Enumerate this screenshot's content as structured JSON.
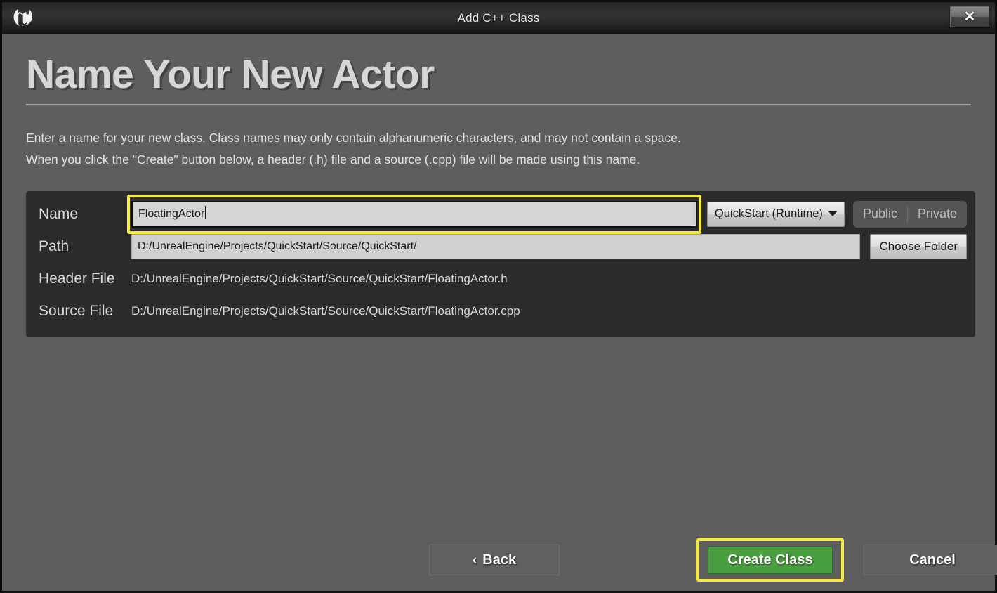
{
  "window": {
    "title": "Add C++ Class",
    "logo_icon": "unreal-engine-logo",
    "close_icon": "✕"
  },
  "page": {
    "heading": "Name Your New Actor",
    "description_line1": "Enter a name for your new class. Class names may only contain alphanumeric characters, and may not contain a space.",
    "description_line2": "When you click the \"Create\" button below, a header (.h) file and a source (.cpp) file will be made using this name."
  },
  "fields": {
    "name": {
      "label": "Name",
      "value": "FloatingActor",
      "highlighted": true
    },
    "module": {
      "label": "QuickStart (Runtime)",
      "chevron_icon": "chevron-down-icon"
    },
    "visibility": {
      "public_label": "Public",
      "private_label": "Private"
    },
    "path": {
      "label": "Path",
      "value": "D:/UnrealEngine/Projects/QuickStart/Source/QuickStart/"
    },
    "choose_folder": {
      "label": "Choose Folder"
    },
    "header_file": {
      "label": "Header File",
      "value": "D:/UnrealEngine/Projects/QuickStart/Source/QuickStart/FloatingActor.h"
    },
    "source_file": {
      "label": "Source File",
      "value": "D:/UnrealEngine/Projects/QuickStart/Source/QuickStart/FloatingActor.cpp"
    }
  },
  "footer": {
    "back_label": "Back",
    "back_chevron": "‹",
    "create_label": "Create Class",
    "cancel_label": "Cancel"
  },
  "colors": {
    "highlight": "#f7e93f",
    "create_green": "#4a9e42",
    "body_background": "#5e5e5e",
    "panel_background": "#2b2b2b"
  }
}
